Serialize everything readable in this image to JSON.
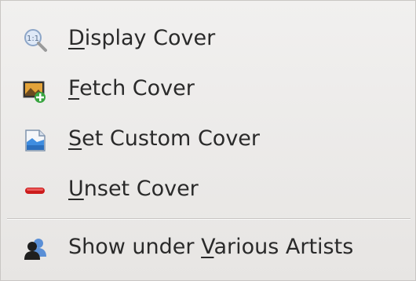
{
  "menu": {
    "items": [
      {
        "pre": "",
        "key": "D",
        "post": "isplay Cover",
        "icon": "zoom-icon"
      },
      {
        "pre": "",
        "key": "F",
        "post": "etch Cover",
        "icon": "fetch-image-icon"
      },
      {
        "pre": "",
        "key": "S",
        "post": "et Custom Cover",
        "icon": "document-image-icon"
      },
      {
        "pre": "",
        "key": "U",
        "post": "nset Cover",
        "icon": "remove-icon"
      },
      {
        "pre": "Show under ",
        "key": "V",
        "post": "arious Artists",
        "icon": "user-group-icon"
      }
    ]
  },
  "colors": {
    "text": "#2a2a2a",
    "remove_red": "#cc1b1b",
    "user_blue": "#5a8fd6"
  }
}
